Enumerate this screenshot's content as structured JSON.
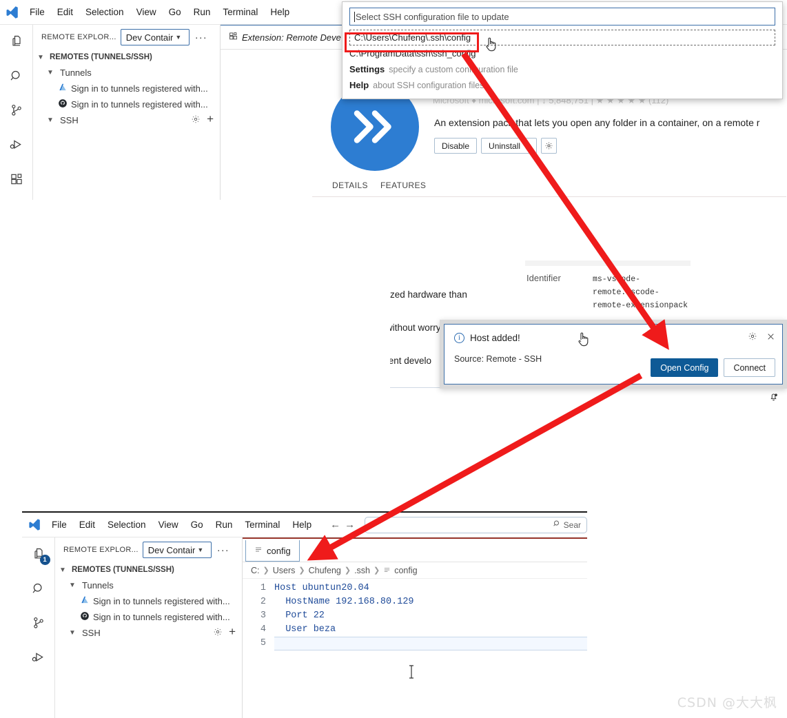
{
  "top_window": {
    "menubar": {
      "logo": "vscode-logo",
      "items": [
        "File",
        "Edit",
        "Selection",
        "View",
        "Go",
        "Run",
        "Terminal",
        "Help"
      ]
    },
    "sidebar": {
      "title": "REMOTE EXPLOR...",
      "dropdown_value": "Dev Contair",
      "more_actions": "···",
      "section": "REMOTES (TUNNELS/SSH)",
      "groups": [
        {
          "label": "Tunnels",
          "children": [
            {
              "icon": "azure-icon",
              "label": "Sign in to tunnels registered with..."
            },
            {
              "icon": "github-icon",
              "label": "Sign in to tunnels registered with..."
            }
          ]
        },
        {
          "label": "SSH",
          "children": []
        }
      ],
      "ssh_actions": [
        "gear-icon",
        "plus-icon"
      ]
    },
    "tab": {
      "icon": "extension-icon",
      "label": "Extension: Remote Deve"
    }
  },
  "quickpick": {
    "placeholder": "Select SSH configuration file to update",
    "items": [
      {
        "label": "C:\\Users\\Chufeng\\.ssh\\config",
        "description": "",
        "selected": true
      },
      {
        "label": "C:\\ProgramData\\ssh\\ssh_config",
        "description": "",
        "selected": false
      },
      {
        "label": "Settings",
        "description": "specify a custom configuration file",
        "selected": false
      },
      {
        "label": "Help",
        "description": "about SSH configuration files",
        "selected": false
      }
    ]
  },
  "extension_pane": {
    "icon": "remote-development-logo",
    "meta_line": "Microsoft  ♦ microsoft.com   |   ↓ 5,848,751   |   ★ ★ ★ ★ ★ (112)",
    "description": "An extension pack that lets you open any folder in a container, on a remote r",
    "buttons": [
      "Disable",
      "Uninstall"
    ],
    "manage_icon": "gear-icon",
    "tabs": [
      "DETAILS",
      "FEATURES"
    ],
    "body_lines": [
      "lized hardware than",
      "without worry",
      "tent develo"
    ],
    "identifier_key": "Identifier",
    "identifier_value": "ms-vscode-\nremote.vscode-\nremote-extensionpack",
    "status_icon": "bell-icon"
  },
  "toast": {
    "icon": "info-icon",
    "title": "Host added!",
    "source": "Source: Remote - SSH",
    "tools": [
      "gear-icon",
      "close-icon"
    ],
    "primary_button": "Open Config",
    "secondary_button": "Connect"
  },
  "bottom_window": {
    "menubar": {
      "logo": "vscode-logo",
      "items": [
        "File",
        "Edit",
        "Selection",
        "View",
        "Go",
        "Run",
        "Terminal",
        "Help"
      ],
      "nav": [
        "back-arrow-icon",
        "forward-arrow-icon"
      ],
      "search_placeholder": "Sear",
      "search_icon": "search-icon"
    },
    "activity_bar": {
      "items": [
        "explorer-icon",
        "search-icon",
        "source-control-icon",
        "run-debug-icon"
      ],
      "explorer_badge": "1"
    },
    "sidebar": {
      "title": "REMOTE EXPLOR...",
      "dropdown_value": "Dev Contair",
      "more_actions": "···",
      "section": "REMOTES (TUNNELS/SSH)",
      "groups": [
        {
          "label": "Tunnels",
          "children": [
            {
              "icon": "azure-icon",
              "label": "Sign in to tunnels registered with..."
            },
            {
              "icon": "github-icon",
              "label": "Sign in to tunnels registered with..."
            }
          ]
        },
        {
          "label": "SSH",
          "children": []
        }
      ],
      "ssh_actions": [
        "gear-icon",
        "plus-icon"
      ]
    },
    "tab": {
      "icon": "file-icon",
      "label": "config"
    },
    "breadcrumb": [
      "C:",
      "Users",
      "Chufeng",
      ".ssh",
      "config"
    ],
    "breadcrumb_file_icon": "file-icon",
    "editor": {
      "line_numbers": [
        "1",
        "2",
        "3",
        "4",
        "5"
      ],
      "lines": [
        "Host ubuntun20.04",
        "  HostName 192.168.80.129",
        "  Port 22",
        "  User beza",
        ""
      ],
      "cursor_line": 5
    }
  },
  "watermark": "CSDN @大大枫",
  "colors": {
    "annotation_red": "#ef1b1b",
    "accent_blue": "#0e5a96",
    "vscode_blue": "#2d7dd2",
    "border_blue": "#3b6ea8"
  }
}
